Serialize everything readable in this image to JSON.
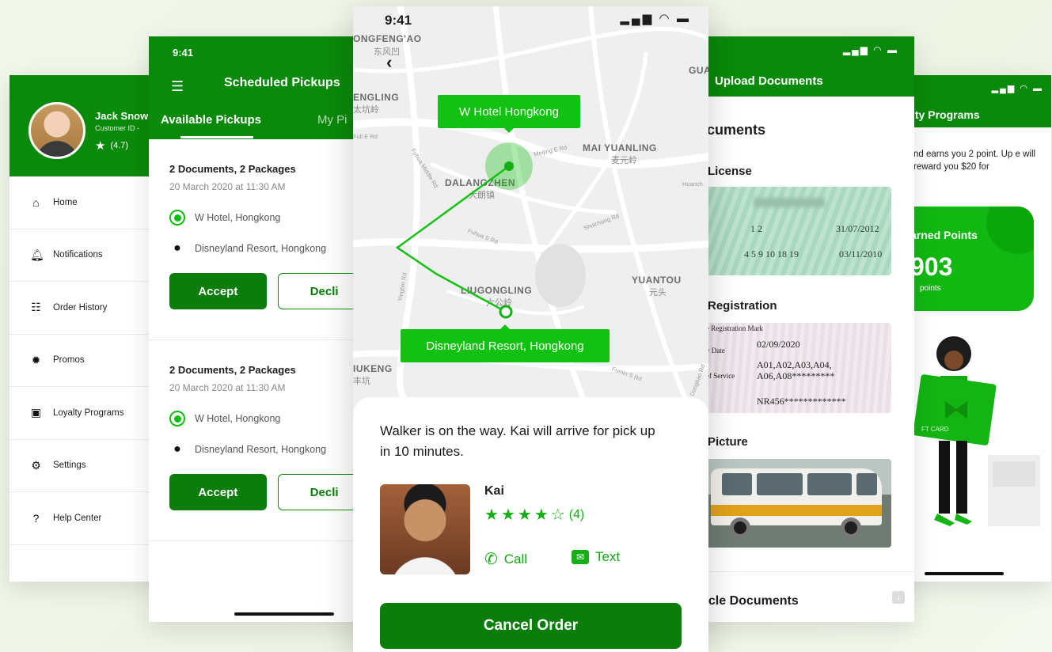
{
  "colors": {
    "brand_green": "#0a8a0a",
    "accent_green": "#13c113",
    "background": "#f1f6ea"
  },
  "drawer": {
    "user_name": "Jack Snow",
    "customer_id": "Customer ID -",
    "rating": "(4.7)",
    "items": [
      {
        "label": "Home",
        "icon": "home-icon"
      },
      {
        "label": "Notifications",
        "icon": "bell-icon"
      },
      {
        "label": "Order History",
        "icon": "list-icon"
      },
      {
        "label": "Promos",
        "icon": "promo-badge-icon"
      },
      {
        "label": "Loyalty Programs",
        "icon": "ticket-icon"
      },
      {
        "label": "Settings",
        "icon": "gear-icon"
      },
      {
        "label": "Help Center",
        "icon": "help-icon"
      }
    ]
  },
  "pickups": {
    "time": "9:41",
    "title": "Scheduled Pickups",
    "tabs": [
      "Available Pickups",
      "My Pi"
    ],
    "cards": [
      {
        "title": "2 Documents, 2 Packages",
        "date": "20 March 2020 at 11:30 AM",
        "from": "W Hotel, Hongkong",
        "to": "Disneyland Resort, Hongkong",
        "accept": "Accept",
        "decline": "Decli"
      },
      {
        "title": "2 Documents, 2 Packages",
        "date": "20 March 2020 at 11:30 AM",
        "from": "W Hotel, Hongkong",
        "to": "Disneyland Resort, Hongkong",
        "accept": "Accept",
        "decline": "Decli"
      }
    ]
  },
  "tracking": {
    "time": "9:41",
    "map_labels": {
      "ngfengao": "ONGFENG'AO",
      "ngfengao_cn": "东风凹",
      "tengling": "ENGLING",
      "tengling_cn": "太坑岭",
      "maiyuanling": "MAI YUANLING",
      "maiyuanling_cn": "麦元岭",
      "dalangzhen": "DALANGZHEN",
      "dalangzhen_cn": "大朗镇",
      "yuantou": "YUANTOU",
      "yuantou_cn": "元头",
      "liugongling": "LIUGONGLING",
      "liugongling_cn": "六公岭",
      "iukeng": "IUKENG",
      "iukeng_cn": "丰坑",
      "gua": "GUA"
    },
    "road_labels": {
      "r1": "Fuli E Rd",
      "r2": "Fuhua Middle Rd",
      "r3": "Meijing E Rd",
      "r4": "Fuhua S Rd",
      "r5": "Shuichang Rd",
      "r6": "Yingbin Rd",
      "r7": "Fumin S Rd",
      "r8": "Huanch",
      "r9": "Dongbao Rd"
    },
    "pickup_label": "W Hotel Hongkong",
    "dropoff_label": "Disneyland Resort, Hongkong",
    "message": "Walker is on the way. Kai will arrive for pick up in 10 minutes.",
    "driver_name": "Kai",
    "driver_rating": 4,
    "driver_rating_max": 5,
    "rating_count": "(4)",
    "call_label": "Call",
    "text_label": "Text",
    "cancel_label": "Cancel Order"
  },
  "documents": {
    "title": "Upload Documents",
    "heading": "ocuments",
    "license_label": "License",
    "license_fields": {
      "f1": "1 2",
      "f2": "31/07/2012",
      "f3": "4 5 9 10 18 19",
      "f4": "03/11/2010"
    },
    "registration_label": "Registration",
    "registration_fields": {
      "mark": "e Registration Mark",
      "date_label": "y Date",
      "date_value": "02/09/2020",
      "service_label": "ef Service",
      "service_value": "A01,A02,A03,A04, A06,A08*********",
      "code_value": "NR456*************"
    },
    "picture_label": "Picture",
    "bottom_label": "ycle Documents"
  },
  "loyalty": {
    "title": "lty Programs",
    "desc": "nd earns you 2 point. Up e will reward you $20 for",
    "points_label": "arned Points",
    "points_value": "903",
    "points_unit": "points"
  }
}
